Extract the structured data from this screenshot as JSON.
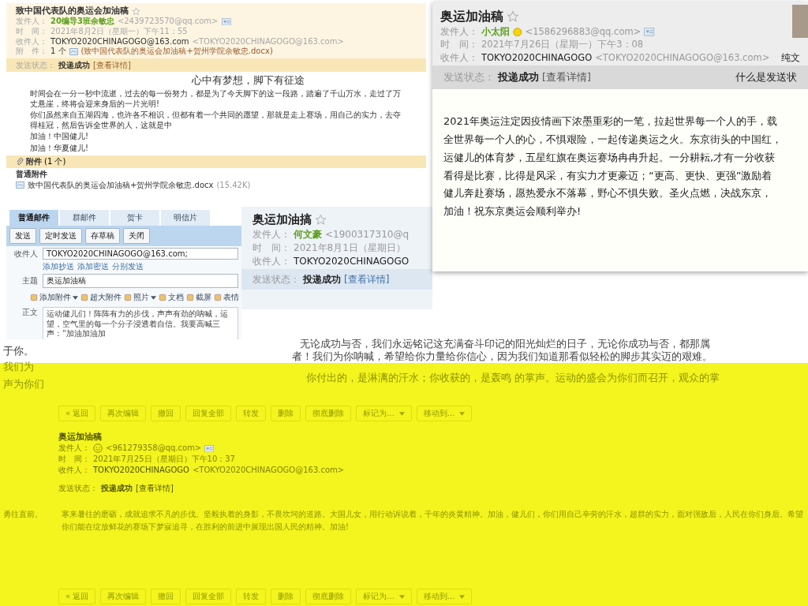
{
  "email_top_left": {
    "title": "致中国代表队的奥运会加油稿",
    "starred": false,
    "sender": {
      "label": "发件人：",
      "name": "20编导3班余敏忠",
      "address": "<2439723570@qq.com>"
    },
    "time": {
      "label": "时　间：",
      "value": "2021年8月2日（星期一）下午11：55"
    },
    "recipient": {
      "label": "收件人：",
      "name": "TOKYO2020CHINAGOGO@163.com",
      "address": "<TOKYO2020CHINAGOGO@163.com>"
    },
    "attachment": {
      "label": "附　件：",
      "count": "1 个",
      "file": "(致中国代表队的奥运会加油稿+贺州学院余敏忠.docx)"
    },
    "status": {
      "label": "发送状态：",
      "value": "投递成功",
      "link": "[查看详情]"
    },
    "body": {
      "heading": "心中有梦想，脚下有征途",
      "paragraphs": [
        "时间会在一分一秒中流逝，过去的每一份努力，都是为了今天脚下的这一段路，踏遍了千山万水，走过了万丈悬崖，终将会迎来身后的一片光明!",
        "你们虽然来自五湖四海，也许各不相识，但都有着一个共同的愿望，那就是走上赛场，用自己的实力，去夺得桂冠，然后告诉全世界的人，这就是中",
        "加油！中国健儿!",
        "加油！华夏健儿!"
      ]
    },
    "attachments_bar": {
      "title": "附件",
      "count": "(1 个)",
      "group": "普通附件",
      "file": "致中国代表队的奥运会加油稿+贺州学院余敏忠.docx",
      "size": "(15.42K)"
    }
  },
  "email_top_right": {
    "title": "奥运加油稿",
    "starred": false,
    "sender": {
      "label": "发件人：",
      "name": "小太阳",
      "address": "<1586296883@qq.com>"
    },
    "time": {
      "label": "时　间：",
      "value": "2021年7月26日（星期一）下午3：08"
    },
    "recipient": {
      "label": "收件人：",
      "name": "TOKYO2020CHINAGOGO",
      "address": "<TOKYO2020CHINAGOGO@163.com>",
      "note": "纯文"
    },
    "status": {
      "label": "发送状态：",
      "value": "投递成功",
      "link": "[查看详情]",
      "note": "什么是发送状"
    },
    "body_lines": [
      "2021年奥运注定因疫情画下浓墨重彩的一笔，拉起世界每一个人的手，载",
      "全世界每一个人的心，不惧艰险，一起传递奥运之火。东京街头的中国红，",
      "运健儿的体育梦，五星红旗在奥运赛场冉冉升起。一分耕耘,才有一分收获",
      "看得是比赛，比得是风采，有实力才更豪迈；“更高、更快、更强”激励着",
      "健儿奔赴赛场，愿热爱永不落幕，野心不惧失败。圣火点燃，决战东京，",
      "加油！祝东京奥运会顺利举办!"
    ]
  },
  "compose_window": {
    "tabs": [
      {
        "label": "普通邮件",
        "selected": true
      },
      {
        "label": "群邮件",
        "selected": false
      },
      {
        "label": "贺卡",
        "selected": false
      },
      {
        "label": "明信片",
        "selected": false
      }
    ],
    "buttons": [
      "发送",
      "定时发送",
      "存草稿",
      "关闭"
    ],
    "to": {
      "label": "收件人",
      "value": "TOKYO2020CHINAGOGO@163.com;"
    },
    "links": [
      "添加抄送",
      "添加密送",
      "分别发送"
    ],
    "subject": {
      "label": "主题",
      "value": "奥运加油稿"
    },
    "tools": [
      {
        "label": "添加附件",
        "kind": "menu"
      },
      {
        "label": "超大附件",
        "kind": "plain"
      },
      {
        "label": "照片",
        "kind": "menu"
      },
      {
        "label": "文档",
        "kind": "plain"
      },
      {
        "label": "截屏",
        "kind": "plain"
      },
      {
        "label": "表情",
        "kind": "plain"
      }
    ],
    "body": {
      "label": "正文",
      "lines": [
        "运动健儿们！阵阵有力的步伐，声声有劲的呐喊，运",
        "望，空气里的每一个分子浸透着自信。我要高喊三声：“加油加油加"
      ]
    }
  },
  "email_middle": {
    "title": "奥运加油搞",
    "starred": false,
    "sender": {
      "label": "发件人：",
      "name": "何文豪",
      "address": "<1900317310@q"
    },
    "time": {
      "label": "时　间：",
      "value": "2021年8月1日（星期日）"
    },
    "recipient": {
      "label": "收件人：",
      "name": "TOKYO2020CHINAGOGO"
    },
    "status": {
      "label": "发送状态：",
      "value": "投递成功",
      "link": "[查看详情]"
    }
  },
  "text_fragments": {
    "left": [
      "于你。",
      "我们为",
      "声为你们"
    ],
    "lines": [
      "无论成功与否，我们永远铭记这充满奋斗印记的阳光灿烂的日子，无论你成功与否，都那属",
      "者！我们为你呐喊，希望给你力量给你信心，因为我们知道那看似轻松的脚步其实迈的艰难。",
      "你付出的，是淋漓的汗水；你收获的，是轰鸣 的掌声。运动的盛会为你们而召开，观众的掌"
    ]
  },
  "email_bottom": {
    "toolbar": [
      {
        "label": "« 返回",
        "kind": "plain"
      },
      {
        "label": "再次编辑",
        "kind": "plain"
      },
      {
        "label": "撤回",
        "kind": "plain"
      },
      {
        "label": "回复全部",
        "kind": "plain"
      },
      {
        "label": "转发",
        "kind": "plain"
      },
      {
        "label": "删除",
        "kind": "plain"
      },
      {
        "label": "彻底删除",
        "kind": "plain"
      },
      {
        "label": "标记为...",
        "kind": "menu"
      },
      {
        "label": "移动到...",
        "kind": "menu"
      }
    ],
    "title": "奥运加油稿",
    "sender": {
      "label": "发件人：",
      "address": "<961279358@qq.com>"
    },
    "time": {
      "label": "时　间：",
      "value": "2021年7月25日（星期日）下午10：37"
    },
    "recipient": {
      "label": "收件人：",
      "name": "TOKYO2020CHINAGOGO",
      "address": "<TOKYO2020CHINAGOGO@163.com>"
    },
    "status": {
      "label": "发送状态：",
      "value": "投递成功",
      "link": "[查看详情]"
    },
    "body_side": "勇往直前。",
    "body": "寒来暑往的磨砺，成就追求不凡的步伐。坚毅执着的身影，不畏坎坷的道路。大国儿女，用行动诉说着，千年的炎黄精神。加油，健儿们，你们用自己辛劳的汗水，超群的实力，面对强敌后，人民在你们身后。希望你们能在绽放鲜花的赛场下梦寐追寻，在胜利的前进中展现出国人民的精神。加油!",
    "bottom_toolbar": [
      {
        "label": "« 返回",
        "kind": "plain"
      },
      {
        "label": "再次编辑",
        "kind": "plain"
      },
      {
        "label": "撤回",
        "kind": "plain"
      },
      {
        "label": "回复全部",
        "kind": "plain"
      },
      {
        "label": "转发",
        "kind": "plain"
      },
      {
        "label": "删除",
        "kind": "plain"
      },
      {
        "label": "彻底删除",
        "kind": "plain"
      },
      {
        "label": "标记为...",
        "kind": "menu"
      },
      {
        "label": "移动到...",
        "kind": "menu"
      }
    ]
  }
}
